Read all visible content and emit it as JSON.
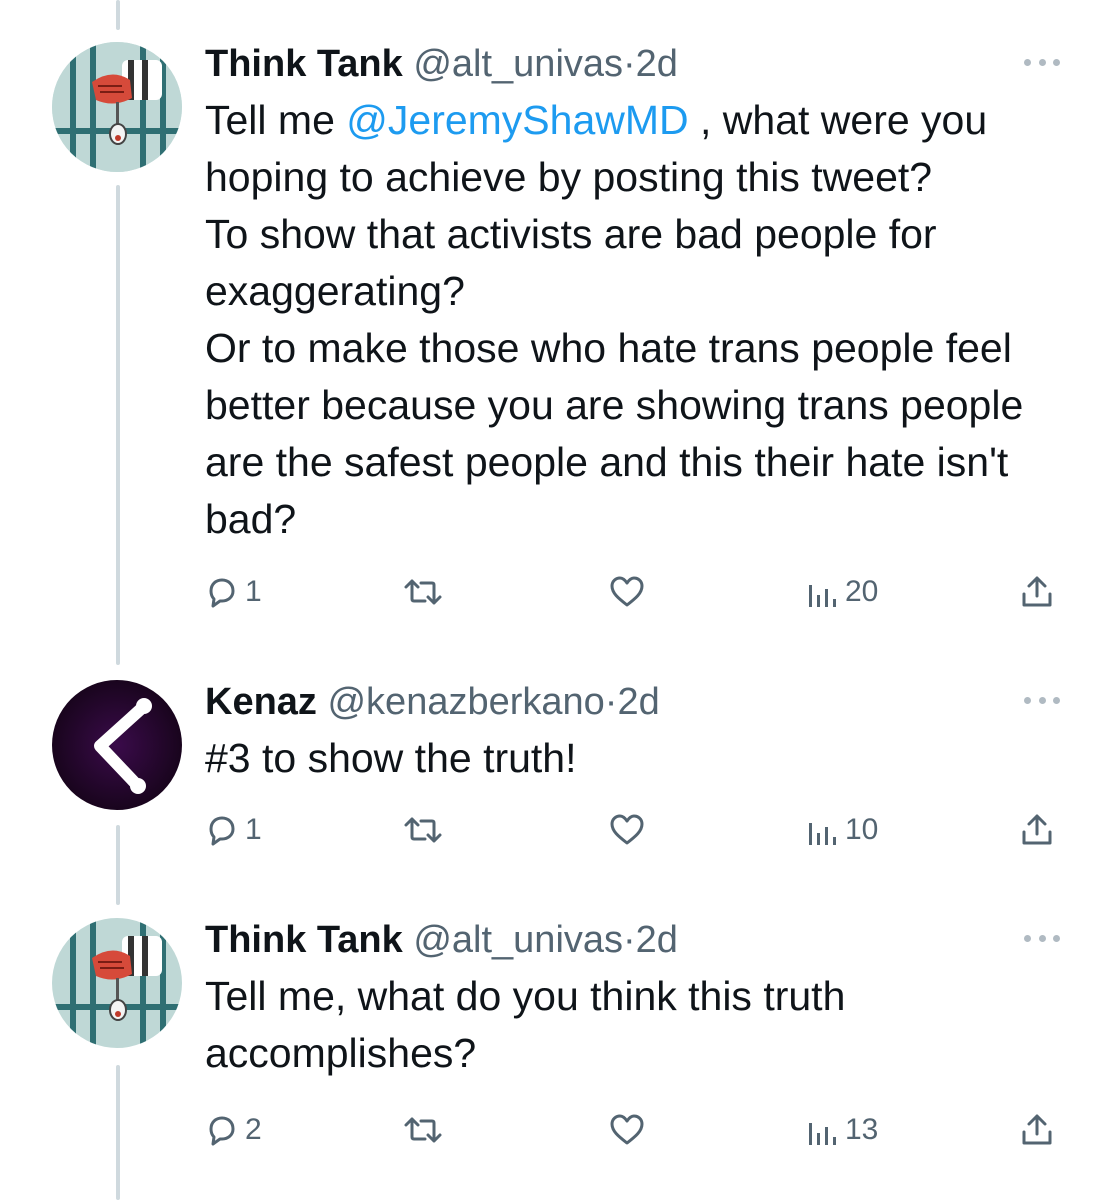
{
  "colors": {
    "text": "#0f1419",
    "secondary": "#536471",
    "link": "#1d9bf0",
    "thread_line": "#cfd9de"
  },
  "tweets": [
    {
      "name": "Think Tank",
      "handle": "@alt_univas",
      "dot": "·",
      "time": "2d",
      "avatar_icon": "prison-bars-hand-avatar",
      "text_before_mention": "Tell me ",
      "mention": "@JeremyShawMD",
      "text_after_mention": " , what were you hoping to achieve by posting this tweet?",
      "paragraphs": [
        "To show that activists are bad people for exaggerating?",
        "Or to make those who hate trans people feel better because you are showing trans people are the safest people and this their hate isn't bad?"
      ],
      "replies": "1",
      "views": "20"
    },
    {
      "name": "Kenaz",
      "handle": "@kenazberkano",
      "dot": "·",
      "time": "2d",
      "avatar_icon": "kenaz-rune-avatar",
      "text": "#3 to show the truth!",
      "replies": "1",
      "views": "10"
    },
    {
      "name": "Think Tank",
      "handle": "@alt_univas",
      "dot": "·",
      "time": "2d",
      "avatar_icon": "prison-bars-hand-avatar",
      "text": "Tell me, what do you think this truth accomplishes?",
      "replies": "2",
      "views": "13"
    }
  ]
}
